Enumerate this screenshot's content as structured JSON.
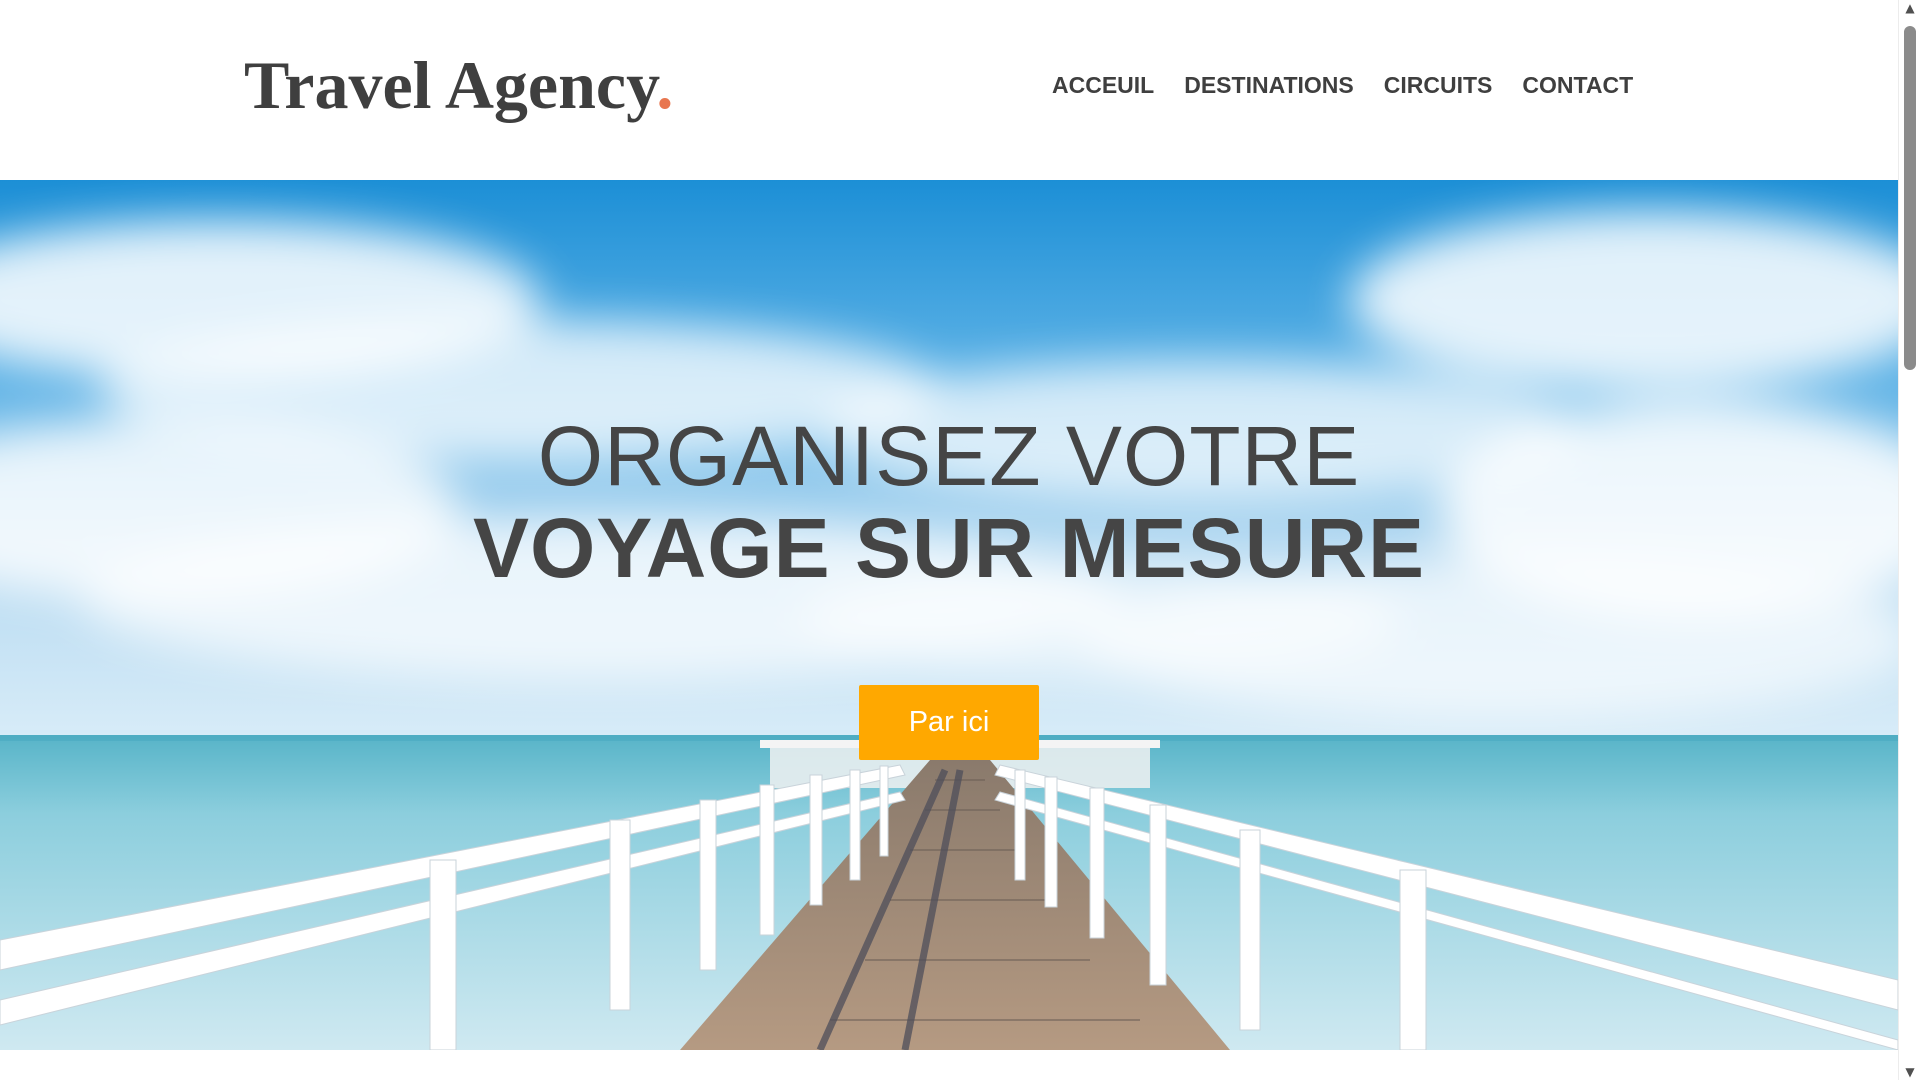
{
  "brand": {
    "name": "Travel Agency",
    "dot": ".",
    "accent_color": "#e8764f"
  },
  "nav": {
    "items": [
      {
        "label": "ACCEUIL"
      },
      {
        "label": "DESTINATIONS"
      },
      {
        "label": "CIRCUITS"
      },
      {
        "label": "CONTACT"
      }
    ]
  },
  "hero": {
    "title_line1": "ORGANISEZ VOTRE",
    "title_line2": "VOYAGE SUR MESURE",
    "cta_label": "Par ici",
    "cta_color": "#ffa800",
    "background": "pier-over-ocean-under-blue-sky"
  },
  "scrollbar": {
    "up_icon": "scroll-up-arrow-icon",
    "down_icon": "scroll-down-arrow-icon"
  }
}
